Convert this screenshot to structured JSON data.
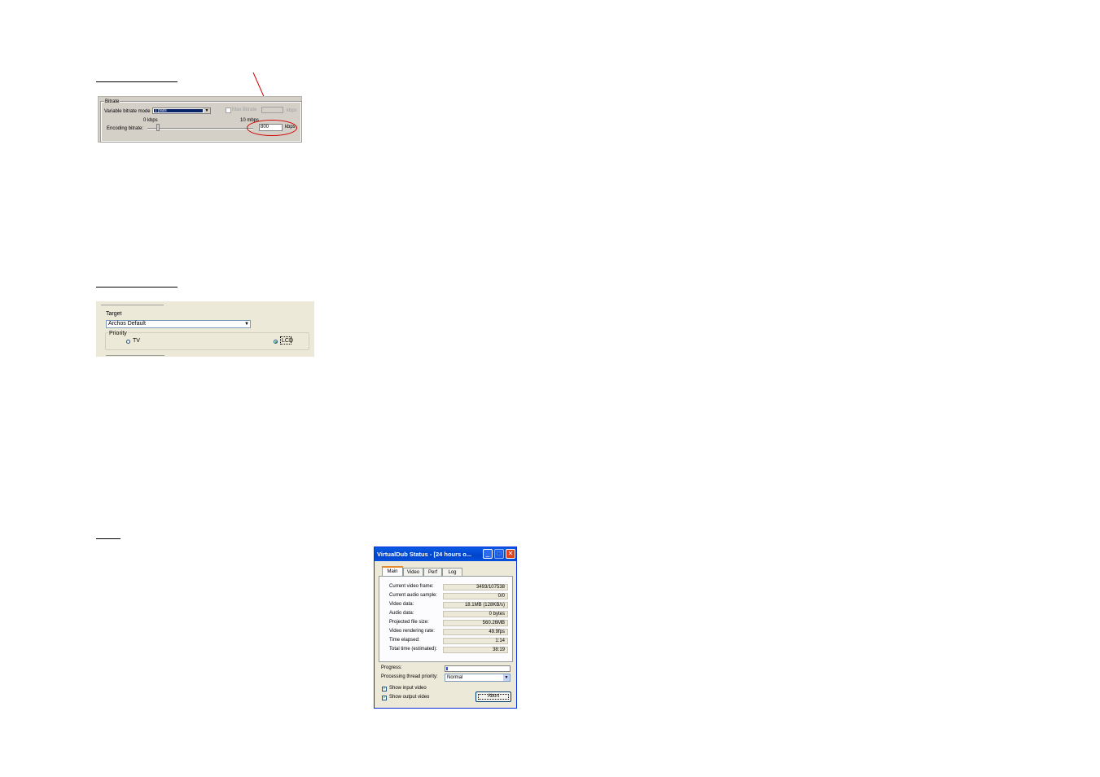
{
  "bitrate_panel": {
    "group_label": "Bitrate",
    "vbr_label": "Variable bitrate mode",
    "vbr_value": "1 pass",
    "max_bitrate_label": "Max Bitrate",
    "max_bitrate_unit": "kbps",
    "min_label": "0 kbps",
    "max_label": "10 mbps",
    "encoding_label": "Encoding bitrate:",
    "encoding_value": "800",
    "encoding_unit": "kbps",
    "slider_level_fraction": 0.08
  },
  "target_panel": {
    "target_label": "Target",
    "target_value": "Archos Default",
    "priority_label": "Priority",
    "option_tv": "TV",
    "option_lcd": "LCD",
    "selected": "LCD"
  },
  "vdub": {
    "title": "VirtualDub Status - [24 hours o...",
    "tabs": [
      "Main",
      "Video",
      "Perf",
      "Log"
    ],
    "stats": [
      {
        "label": "Current video frame:",
        "value": "3493/107538"
      },
      {
        "label": "Current audio sample:",
        "value": "0/0"
      },
      {
        "label": "Video data:",
        "value": "18.1MB (128KB/s)"
      },
      {
        "label": "Audio data:",
        "value": "0 bytes"
      },
      {
        "label": "Projected file size:",
        "value": "560.26MB"
      },
      {
        "label": "Video rendering rate:",
        "value": "49.9fps"
      },
      {
        "label": "Time elapsed:",
        "value": "1:14"
      },
      {
        "label": "Total time (estimated):",
        "value": "38:19"
      }
    ],
    "progress_label": "Progress:",
    "progress_fraction": 0.03,
    "priority_label": "Processing thread priority:",
    "priority_value": "Normal",
    "show_input_label": "Show input video",
    "show_output_label": "Show output video",
    "abort_label": "Abort",
    "colors": {
      "titlebar": "#0a5ce6",
      "close": "#e0451d",
      "progress": "#2555c8"
    }
  },
  "annotation_color": "#d00000"
}
